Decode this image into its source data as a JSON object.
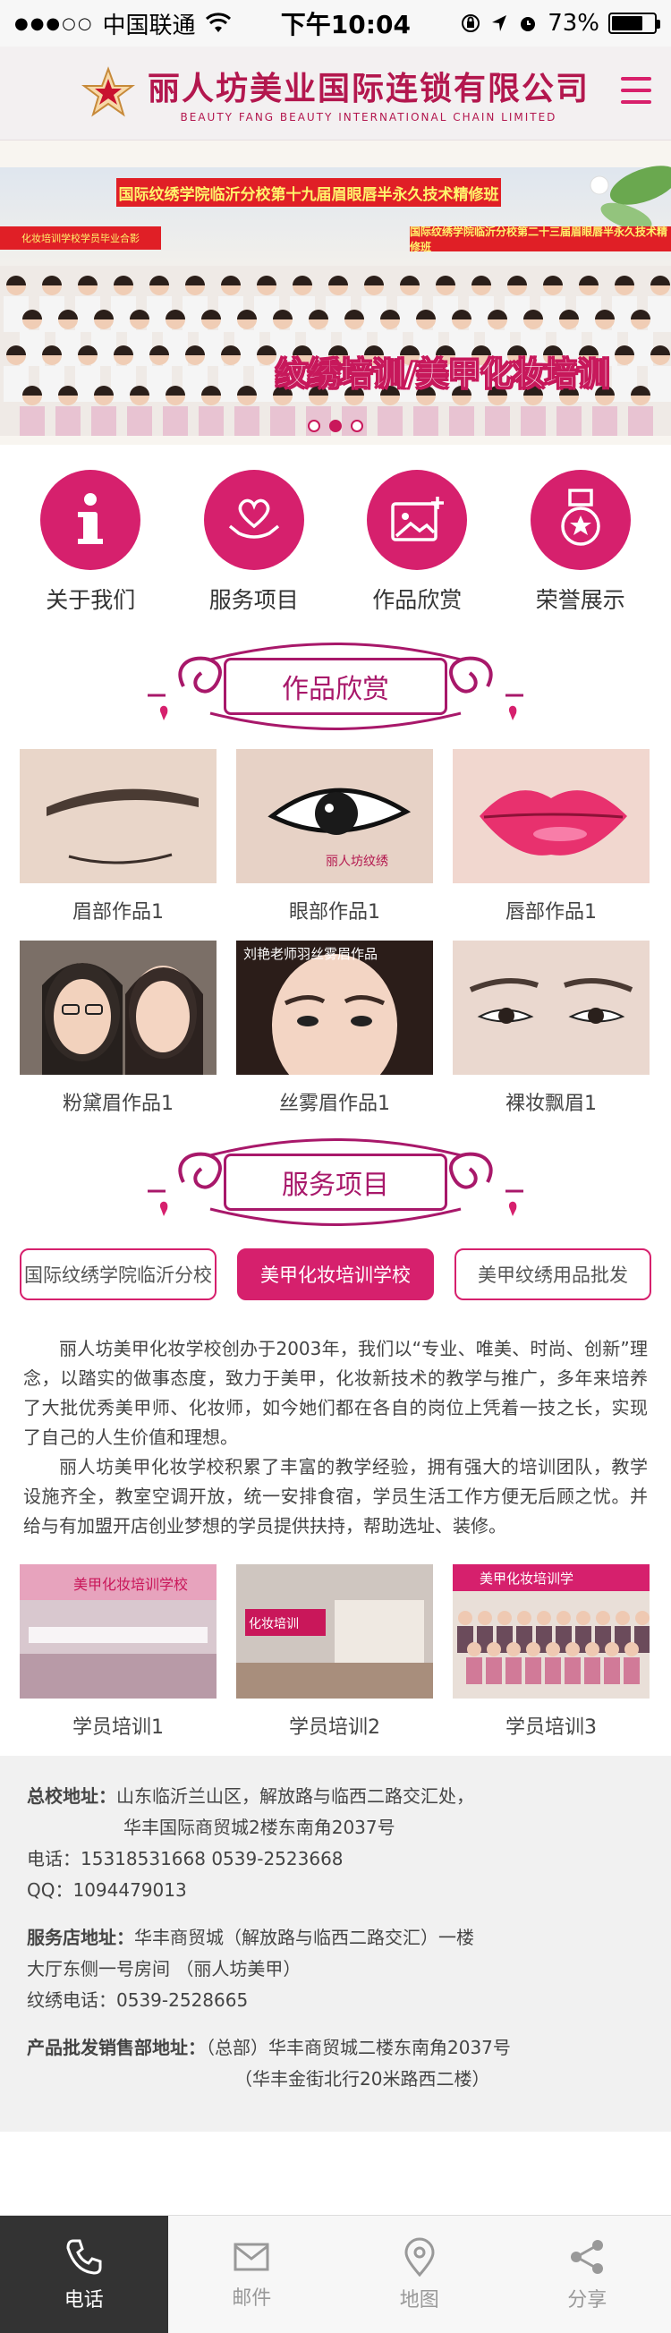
{
  "status": {
    "carrier": "中国联通",
    "time": "下午10:04",
    "battery": "73%",
    "battery_level": 0.73
  },
  "header": {
    "logo_cn": "丽人坊美业国际连锁有限公司",
    "logo_en": "BEAUTY FANG BEAUTY INTERNATIONAL CHAIN LIMITED"
  },
  "banner": {
    "caption_top": "国际纹绣学院临沂分校第十九届眉眼唇半永久技术精修班",
    "caption_right": "国际纹绣学院临沂分校第二十三届眉眼唇半永久技术精修班",
    "caption_left": "化妆培训学校学员毕业合影",
    "slogan": "纹绣培训/美甲化妆培训",
    "slides": 3,
    "active_slide": 2
  },
  "nav": [
    {
      "label": "关于我们",
      "icon": "info-icon"
    },
    {
      "label": "服务项目",
      "icon": "heart-hand-icon"
    },
    {
      "label": "作品欣赏",
      "icon": "image-add-icon"
    },
    {
      "label": "荣誉展示",
      "icon": "medal-icon"
    }
  ],
  "works": {
    "title": "作品欣赏",
    "items": [
      {
        "label": "眉部作品1"
      },
      {
        "label": "眼部作品1",
        "watermark": "丽人坊纹绣"
      },
      {
        "label": "唇部作品1"
      },
      {
        "label": "粉黛眉作品1"
      },
      {
        "label": "丝雾眉作品1",
        "watermark": "刘艳老师羽丝雾眉作品"
      },
      {
        "label": "裸妆飘眉1"
      }
    ]
  },
  "services": {
    "title": "服务项目",
    "tabs": [
      {
        "label": "国际纹绣学院临沂分校"
      },
      {
        "label": "美甲化妆培训学校"
      },
      {
        "label": "美甲纹绣用品批发"
      }
    ],
    "active_tab": 1,
    "intro": [
      "丽人坊美甲化妆学校创办于2003年，我们以“专业、唯美、时尚、创新”理念，以踏实的做事态度，致力于美甲，化妆新技术的教学与推广，多年来培养了大批优秀美甲师、化妆师，如今她们都在各自的岗位上凭着一技之长，实现了自己的人生价值和理想。",
      "丽人坊美甲化妆学校积累了丰富的教学经验，拥有强大的培训团队，教学设施齐全，教室空调开放，统一安排食宿，学员生活工作方便无后顾之忧。并给与有加盟开店创业梦想的学员提供扶持，帮助选址、装修。"
    ],
    "photos": [
      {
        "label": "学员培训1",
        "sign": "美甲化妆培训学校"
      },
      {
        "label": "学员培训2",
        "sign": "化妆培训"
      },
      {
        "label": "学员培训3",
        "sign": "美甲化妆培训学"
      }
    ]
  },
  "info": {
    "hq_label": "总校地址：",
    "hq_line1": "山东临沂兰山区，解放路与临西二路交汇处，",
    "hq_line2": "华丰国际商贸城2楼东南角2037号",
    "phone": "电话：15318531668  0539-2523668",
    "qq": "QQ：1094479013",
    "store_label": "服务店地址：",
    "store_line1": "华丰商贸城（解放路与临西二路交汇）一楼",
    "store_line2": "大厅东侧一号房间 （丽人坊美甲）",
    "store_phone": "纹绣电话：0539-2528665",
    "wholesale_label": "产品批发销售部地址：",
    "wholesale_line1": "（总部）华丰商贸城二楼东南角2037号",
    "wholesale_line2": "（华丰金街北行20米路西二楼）"
  },
  "bottom_bar": [
    {
      "label": "电话",
      "icon": "phone-icon"
    },
    {
      "label": "邮件",
      "icon": "mail-icon"
    },
    {
      "label": "地图",
      "icon": "map-pin-icon"
    },
    {
      "label": "分享",
      "icon": "share-icon"
    }
  ],
  "colors": {
    "accent": "#d6206d",
    "brand": "#b3174e",
    "title_purple": "#a8186a"
  }
}
